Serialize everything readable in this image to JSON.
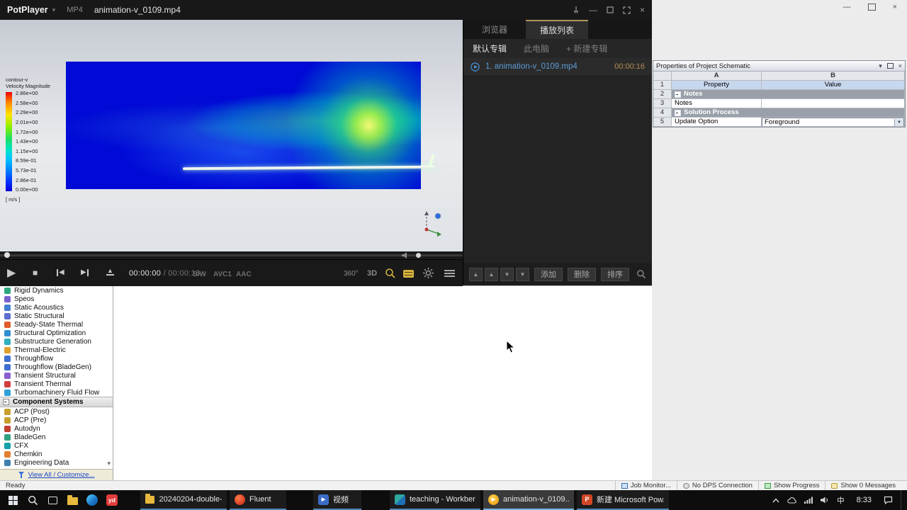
{
  "icons": {
    "play": "▶",
    "stop": "■",
    "prev_arrow": "◀",
    "next_arrow": "▶",
    "up": "▲",
    "down": "▼",
    "minimize": "—",
    "close": "×",
    "chevron_down": "▾"
  },
  "potplayer": {
    "title": {
      "app": "PotPlayer",
      "format": "MP4",
      "filename": "animation-v_0109.mp4"
    },
    "legend": {
      "line1": "contour-v",
      "line2": "Velocity Magnitude",
      "ticks": [
        "2.86e+00",
        "2.58e+00",
        "2.29e+00",
        "2.01e+00",
        "1.72e+00",
        "1.43e+00",
        "1.15e+00",
        "8.59e-01",
        "5.73e-01",
        "2.86e-01",
        "0.00e+00"
      ],
      "unit": "[ m/s ]"
    },
    "controls": {
      "time_current": "00:00:00",
      "time_divider": "/",
      "time_total": "00:00:16",
      "render_mode": "S/W",
      "video_codec": "AVC1",
      "audio_codec": "AAC",
      "badge_360": "360°",
      "badge_3d": "3D"
    },
    "playlist": {
      "tab_browser": "浏览器",
      "tab_playlist": "播放列表",
      "subtab_default": "默认专辑",
      "subtab_thispc": "此电脑",
      "subtab_new": "+ 新建专辑",
      "item": {
        "title": "1. animation-v_0109.mp4",
        "duration": "00:00:16"
      },
      "btn_add": "添加",
      "btn_delete": "删除",
      "btn_sort": "排序"
    }
  },
  "workbench": {
    "toolbox_items": [
      {
        "label": "Rigid Dynamics",
        "color": "#2fa87c"
      },
      {
        "label": "Speos",
        "color": "#7a5fd0"
      },
      {
        "label": "Static Acoustics",
        "color": "#3f7fd0"
      },
      {
        "label": "Static Structural",
        "color": "#5b6ed0"
      },
      {
        "label": "Steady-State Thermal",
        "color": "#e05c2c"
      },
      {
        "label": "Structural Optimization",
        "color": "#2f8fd0"
      },
      {
        "label": "Substructure Generation",
        "color": "#2fb0c0"
      },
      {
        "label": "Thermal-Electric",
        "color": "#e0a02c"
      },
      {
        "label": "Throughflow",
        "color": "#3f6fd0"
      },
      {
        "label": "Throughflow (BladeGen)",
        "color": "#3f6fd0"
      },
      {
        "label": "Transient Structural",
        "color": "#8a5fd0"
      },
      {
        "label": "Transient Thermal",
        "color": "#d04040"
      },
      {
        "label": "Turbomachinery Fluid Flow",
        "color": "#2fa0d8"
      }
    ],
    "toolbox_section": "Component Systems",
    "component_items": [
      {
        "label": "ACP (Post)",
        "color": "#c8a030"
      },
      {
        "label": "ACP (Pre)",
        "color": "#c8a030"
      },
      {
        "label": "Autodyn",
        "color": "#c04030"
      },
      {
        "label": "BladeGen",
        "color": "#30a080"
      },
      {
        "label": "CFX",
        "color": "#10a0a8"
      },
      {
        "label": "Chemkin",
        "color": "#e08030"
      },
      {
        "label": "Engineering Data",
        "color": "#4080b0"
      }
    ],
    "toolbox_footer": "View All / Customize...",
    "properties": {
      "title": "Properties of Project Schematic",
      "col_a": "A",
      "col_b": "B",
      "rows": [
        {
          "num": "1",
          "a": "Property",
          "b": "Value"
        },
        {
          "num": "2",
          "band": "Notes"
        },
        {
          "num": "3",
          "a": "Notes",
          "b": ""
        },
        {
          "num": "4",
          "band": "Solution Process"
        },
        {
          "num": "5",
          "a": "Update Option",
          "b": "Foreground"
        }
      ]
    },
    "status_ready": "Ready",
    "status_segments": [
      "Job Monitor...",
      "No DPS Connection",
      "Show Progress",
      "Show 0 Messages"
    ]
  },
  "taskbar": {
    "youdao": "yd",
    "buttons": [
      {
        "label": "20240204-double-..."
      },
      {
        "label": "Fluent"
      },
      {
        "label": "视频"
      },
      {
        "label": "teaching - Workben..."
      },
      {
        "label": "animation-v_0109..."
      },
      {
        "label": "新建 Microsoft Pow..."
      }
    ],
    "ime": "中",
    "clock": "8:33"
  }
}
